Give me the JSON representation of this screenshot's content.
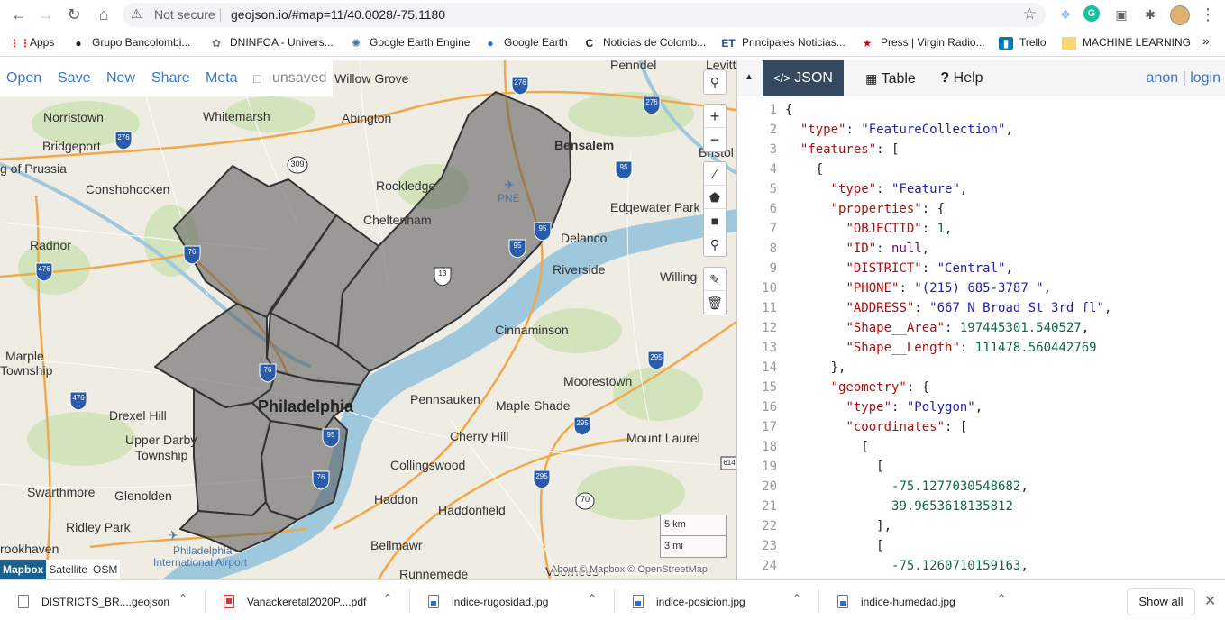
{
  "browser": {
    "security_label": "Not secure",
    "url": "geojson.io/#map=11/40.0028/-75.1180",
    "bookmarks": [
      {
        "label": "Apps",
        "icon": "apps-grid-icon"
      },
      {
        "label": "Grupo Bancolombi...",
        "icon": "globe-icon"
      },
      {
        "label": "DNINFOA - Univers...",
        "icon": "seal-icon"
      },
      {
        "label": "Google Earth Engine",
        "icon": "gear-globe-icon"
      },
      {
        "label": "Google Earth",
        "icon": "earth-icon"
      },
      {
        "label": "Noticias de Colomb...",
        "icon": "newspaper-icon"
      },
      {
        "label": "Principales Noticias...",
        "icon": "et-logo-icon"
      },
      {
        "label": "Press | Virgin Radio...",
        "icon": "star-logo-icon"
      },
      {
        "label": "Trello",
        "icon": "trello-icon"
      },
      {
        "label": "MACHINE LEARNING",
        "icon": "folder-icon"
      }
    ],
    "bookmarks_more": "»"
  },
  "map": {
    "menu": {
      "open": "Open",
      "save": "Save",
      "new": "New",
      "share": "Share",
      "meta": "Meta",
      "status": "unsaved"
    },
    "labels": {
      "willow_grove": "Willow Grove",
      "penndel": "Penndel",
      "levittown": "Levitt",
      "norristown": "Norristown",
      "whitemarsh": "Whitemarsh",
      "abington": "Abington",
      "bensalem": "Bensalem",
      "bristol": "Bristol",
      "bridgeport": "Bridgeport",
      "king_of_prussia": "g of Prussia",
      "conshohocken": "Conshohocken",
      "rockledge": "Rockledge",
      "pne": "PNE",
      "cheltenham": "Cheltenham",
      "edgewater_park": "Edgewater Park",
      "radnor": "Radnor",
      "delanco": "Delanco",
      "riverside": "Riverside",
      "willing": "Willing",
      "cinnaminson": "Cinnaminson",
      "marple": "Marple",
      "township": "Township",
      "moorestown": "Moorestown",
      "philadelphia": "Philadelphia",
      "pennsauken": "Pennsauken",
      "maple_shade": "Maple Shade",
      "drexel_hill": "Drexel Hill",
      "cherry_hill": "Cherry Hill",
      "upper_darby": "Upper Darby",
      "upper_darby_2": "Township",
      "mount_laurel": "Mount Laurel",
      "collingswood": "Collingswood",
      "swarthmore": "Swarthmore",
      "glenolden": "Glenolden",
      "haddon": "Haddon",
      "haddonfield": "Haddonfield",
      "ridley_park": "Ridley Park",
      "rookhaven": "rookhaven",
      "airport": "Philadelphia",
      "airport_2": "International Airport",
      "bellmawr": "Bellmawr",
      "runnemede": "Runnemede",
      "voorhees": "Voorhees"
    },
    "shields": [
      "276",
      "276",
      "276",
      "309",
      "95",
      "95",
      "476",
      "476",
      "476",
      "76",
      "13",
      "76",
      "95",
      "95",
      "295",
      "295",
      "295",
      "70",
      "76",
      "614"
    ],
    "scale": {
      "metric": "5 km",
      "imperial": "3 mi"
    },
    "layers": [
      "Mapbox",
      "Satellite",
      "OSM"
    ],
    "attribution": "About © Mapbox © OpenStreetMap",
    "colors": {
      "district_fill": "#555555",
      "district_stroke": "#333333",
      "water": "#9fc8dc"
    }
  },
  "panel": {
    "tabs": [
      {
        "label": "JSON",
        "icon": "code-icon"
      },
      {
        "label": "Table",
        "icon": "table-icon"
      },
      {
        "label": "Help",
        "icon": "question-icon"
      }
    ],
    "user": {
      "anon": "anon",
      "sep": " | ",
      "login": "login"
    },
    "code_lines": [
      "{",
      "  \"type\": \"FeatureCollection\",",
      "  \"features\": [",
      "    {",
      "      \"type\": \"Feature\",",
      "      \"properties\": {",
      "        \"OBJECTID\": 1,",
      "        \"ID\": null,",
      "        \"DISTRICT\": \"Central\",",
      "        \"PHONE\": \"(215) 685-3787 \",",
      "        \"ADDRESS\": \"667 N Broad St 3rd fl\",",
      "        \"Shape__Area\": 197445301.540527,",
      "        \"Shape__Length\": 111478.560442769",
      "      },",
      "      \"geometry\": {",
      "        \"type\": \"Polygon\",",
      "        \"coordinates\": [",
      "          [",
      "            [",
      "              -75.1277030548682,",
      "              39.9653618135812",
      "            ],",
      "            [",
      "              -75.1260710159163,"
    ]
  },
  "downloads": {
    "items": [
      {
        "name": "DISTRICTS_BR....geojson",
        "type": "file"
      },
      {
        "name": "Vanackeretal2020P....pdf",
        "type": "pdf"
      },
      {
        "name": "indice-rugosidad.jpg",
        "type": "jpg"
      },
      {
        "name": "indice-posicion.jpg",
        "type": "jpg"
      },
      {
        "name": "indice-humedad.jpg",
        "type": "jpg"
      }
    ],
    "show_all": "Show all"
  }
}
